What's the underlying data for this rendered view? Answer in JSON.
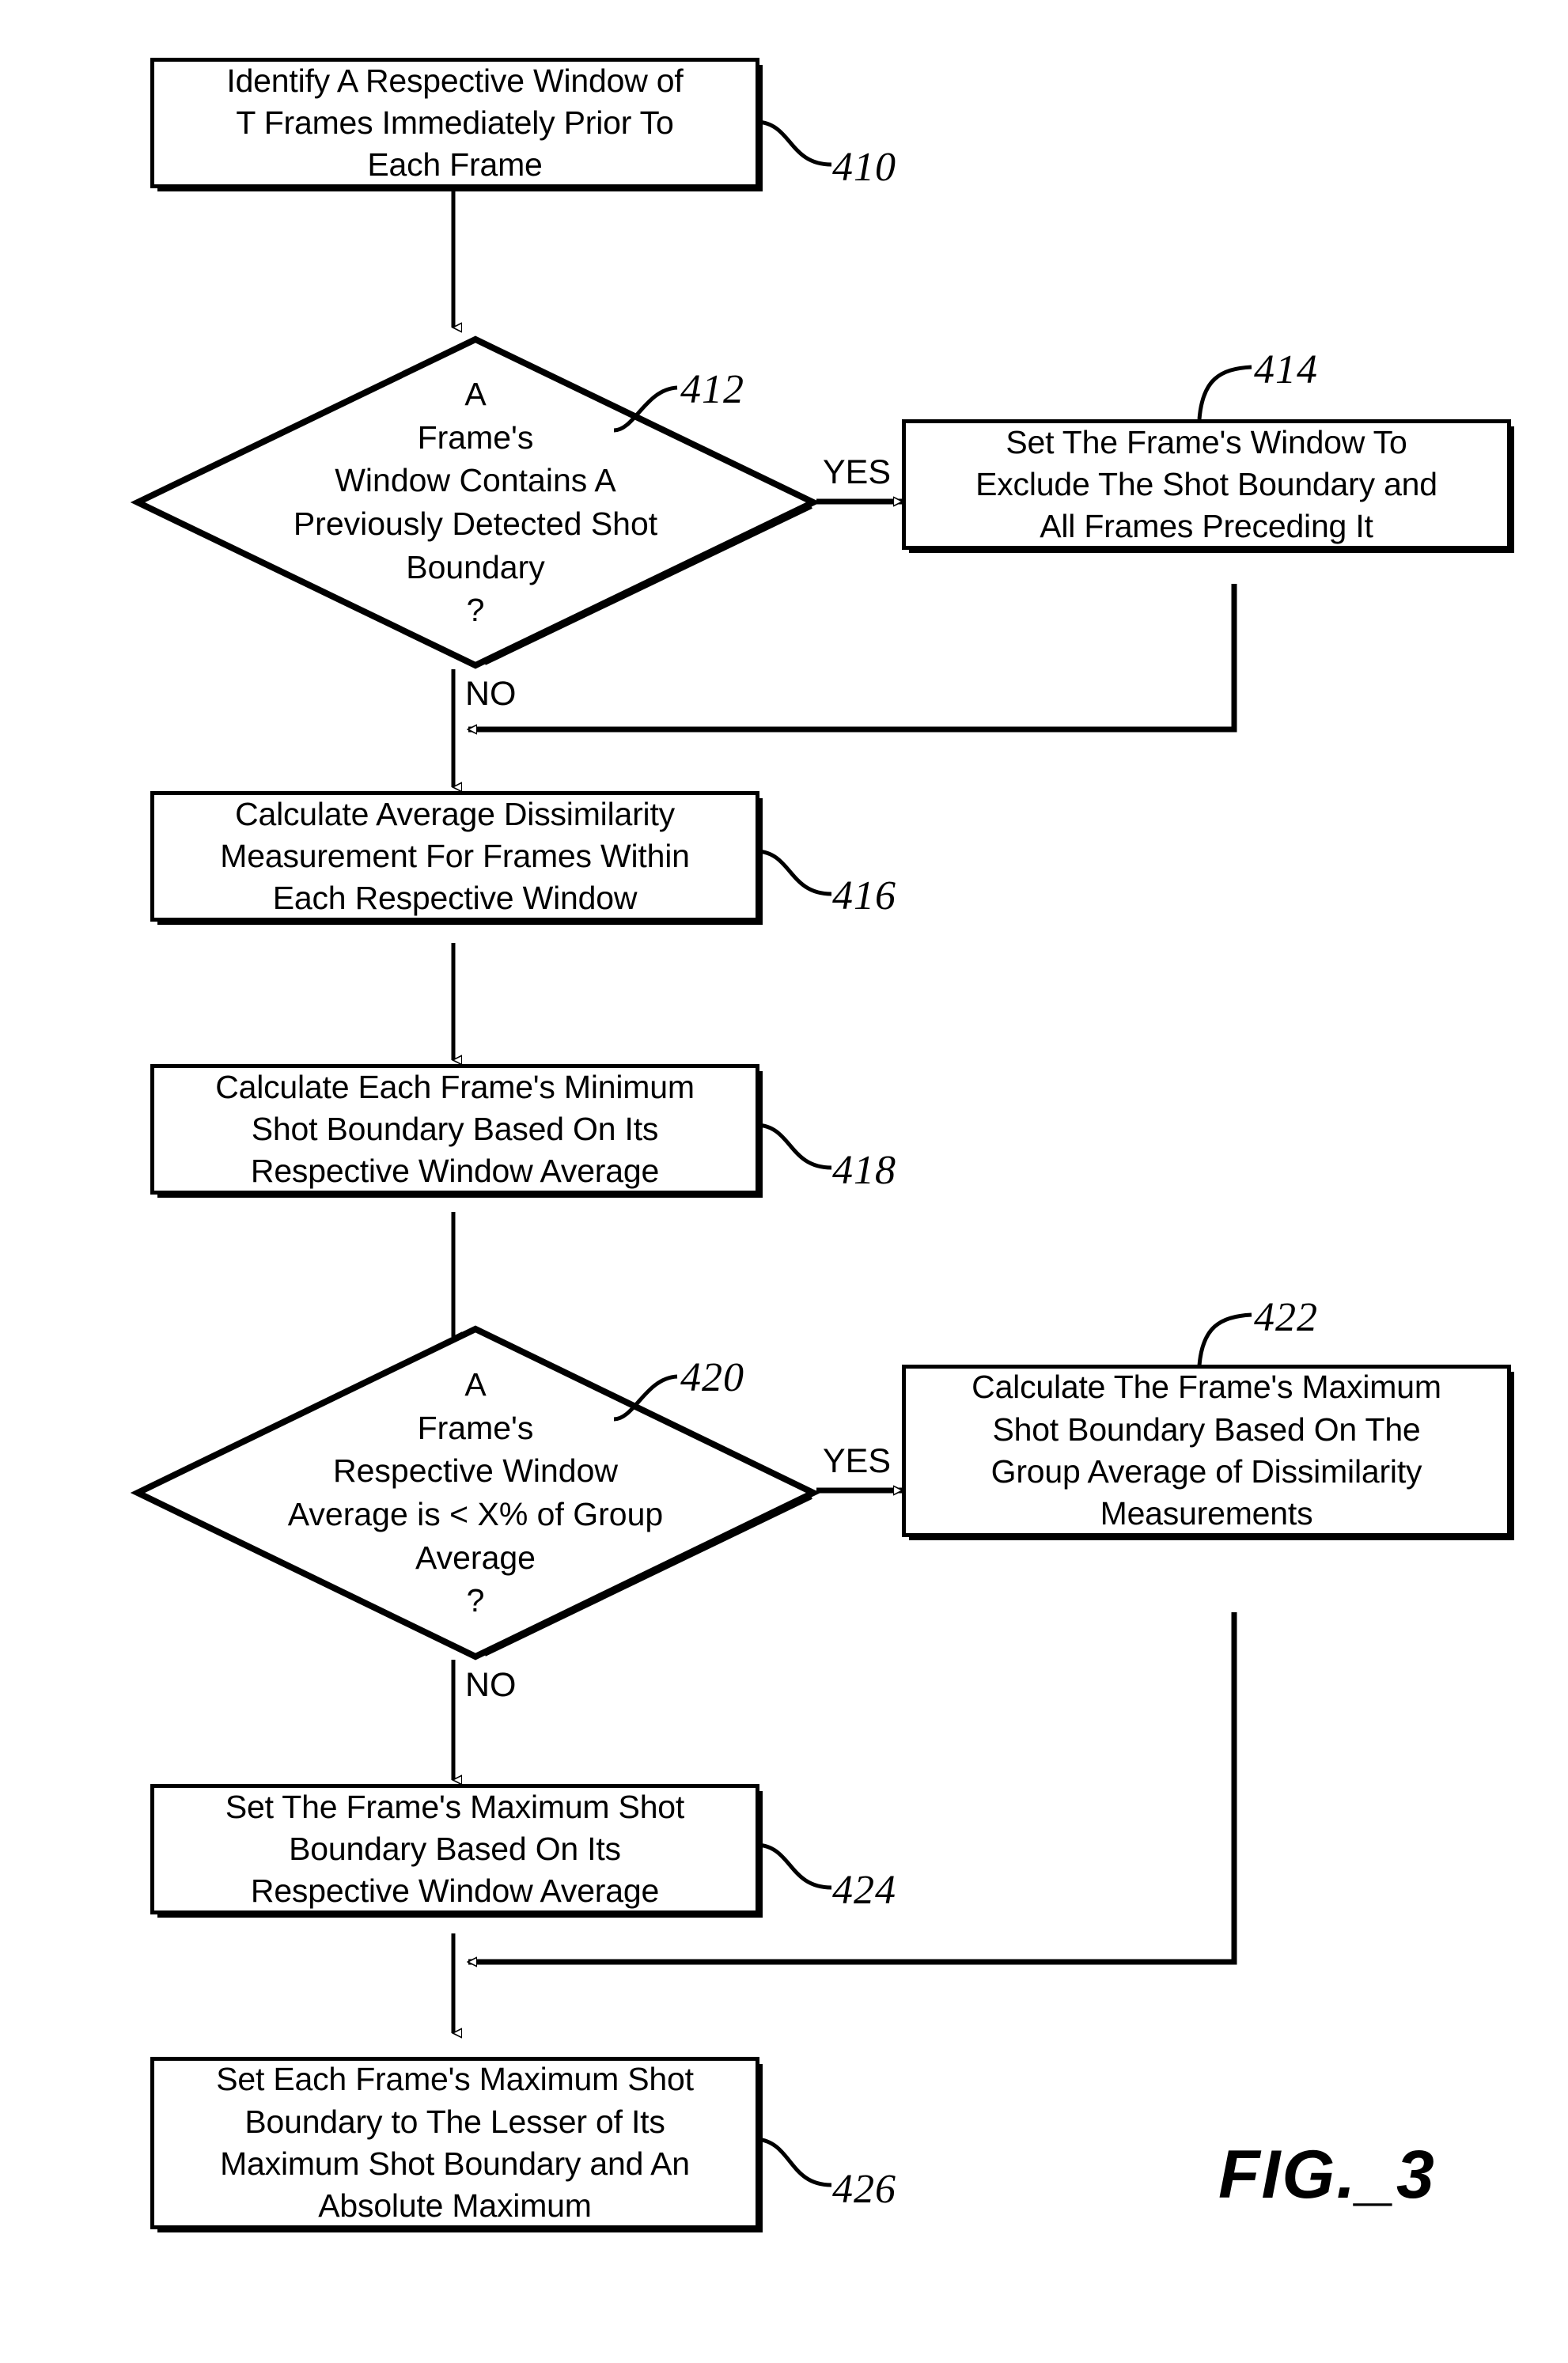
{
  "figure": {
    "caption": "FIG._3",
    "edge_labels": {
      "yes": "YES",
      "no": "NO"
    }
  },
  "nodes": [
    {
      "id": "410",
      "shape": "process",
      "ref": "410",
      "text": "Identify A Respective Window of\nT Frames Immediately Prior To\nEach Frame"
    },
    {
      "id": "412",
      "shape": "decision",
      "ref": "412",
      "text": "A\nFrame's\nWindow Contains A\nPreviously Detected Shot\nBoundary\n?"
    },
    {
      "id": "414",
      "shape": "process",
      "ref": "414",
      "text": "Set The Frame's Window To\nExclude The Shot Boundary and\nAll Frames Preceding It"
    },
    {
      "id": "416",
      "shape": "process",
      "ref": "416",
      "text": "Calculate Average Dissimilarity\nMeasurement For Frames Within\nEach Respective Window"
    },
    {
      "id": "418",
      "shape": "process",
      "ref": "418",
      "text": "Calculate Each Frame's Minimum\nShot Boundary Based On Its\nRespective Window Average"
    },
    {
      "id": "420",
      "shape": "decision",
      "ref": "420",
      "text": "A\nFrame's\nRespective Window\nAverage is < X% of Group\nAverage\n?"
    },
    {
      "id": "422",
      "shape": "process",
      "ref": "422",
      "text": "Calculate The Frame's Maximum\nShot Boundary Based On The\nGroup Average of Dissimilarity\nMeasurements"
    },
    {
      "id": "424",
      "shape": "process",
      "ref": "424",
      "text": "Set The Frame's Maximum Shot\nBoundary Based On Its\nRespective Window Average"
    },
    {
      "id": "426",
      "shape": "process",
      "ref": "426",
      "text": "Set Each Frame's Maximum Shot\nBoundary to The Lesser of Its\nMaximum Shot Boundary and An\nAbsolute Maximum"
    }
  ],
  "edges": [
    {
      "from": "410",
      "to": "412",
      "label": ""
    },
    {
      "from": "412",
      "to": "414",
      "label": "YES"
    },
    {
      "from": "412",
      "to": "416",
      "label": "NO"
    },
    {
      "from": "414",
      "to": "416",
      "label": ""
    },
    {
      "from": "416",
      "to": "418",
      "label": ""
    },
    {
      "from": "418",
      "to": "420",
      "label": ""
    },
    {
      "from": "420",
      "to": "422",
      "label": "YES"
    },
    {
      "from": "420",
      "to": "424",
      "label": "NO"
    },
    {
      "from": "424",
      "to": "426",
      "label": ""
    },
    {
      "from": "422",
      "to": "426",
      "label": ""
    }
  ],
  "colors": {
    "ink": "#000000",
    "paper": "#ffffff"
  }
}
